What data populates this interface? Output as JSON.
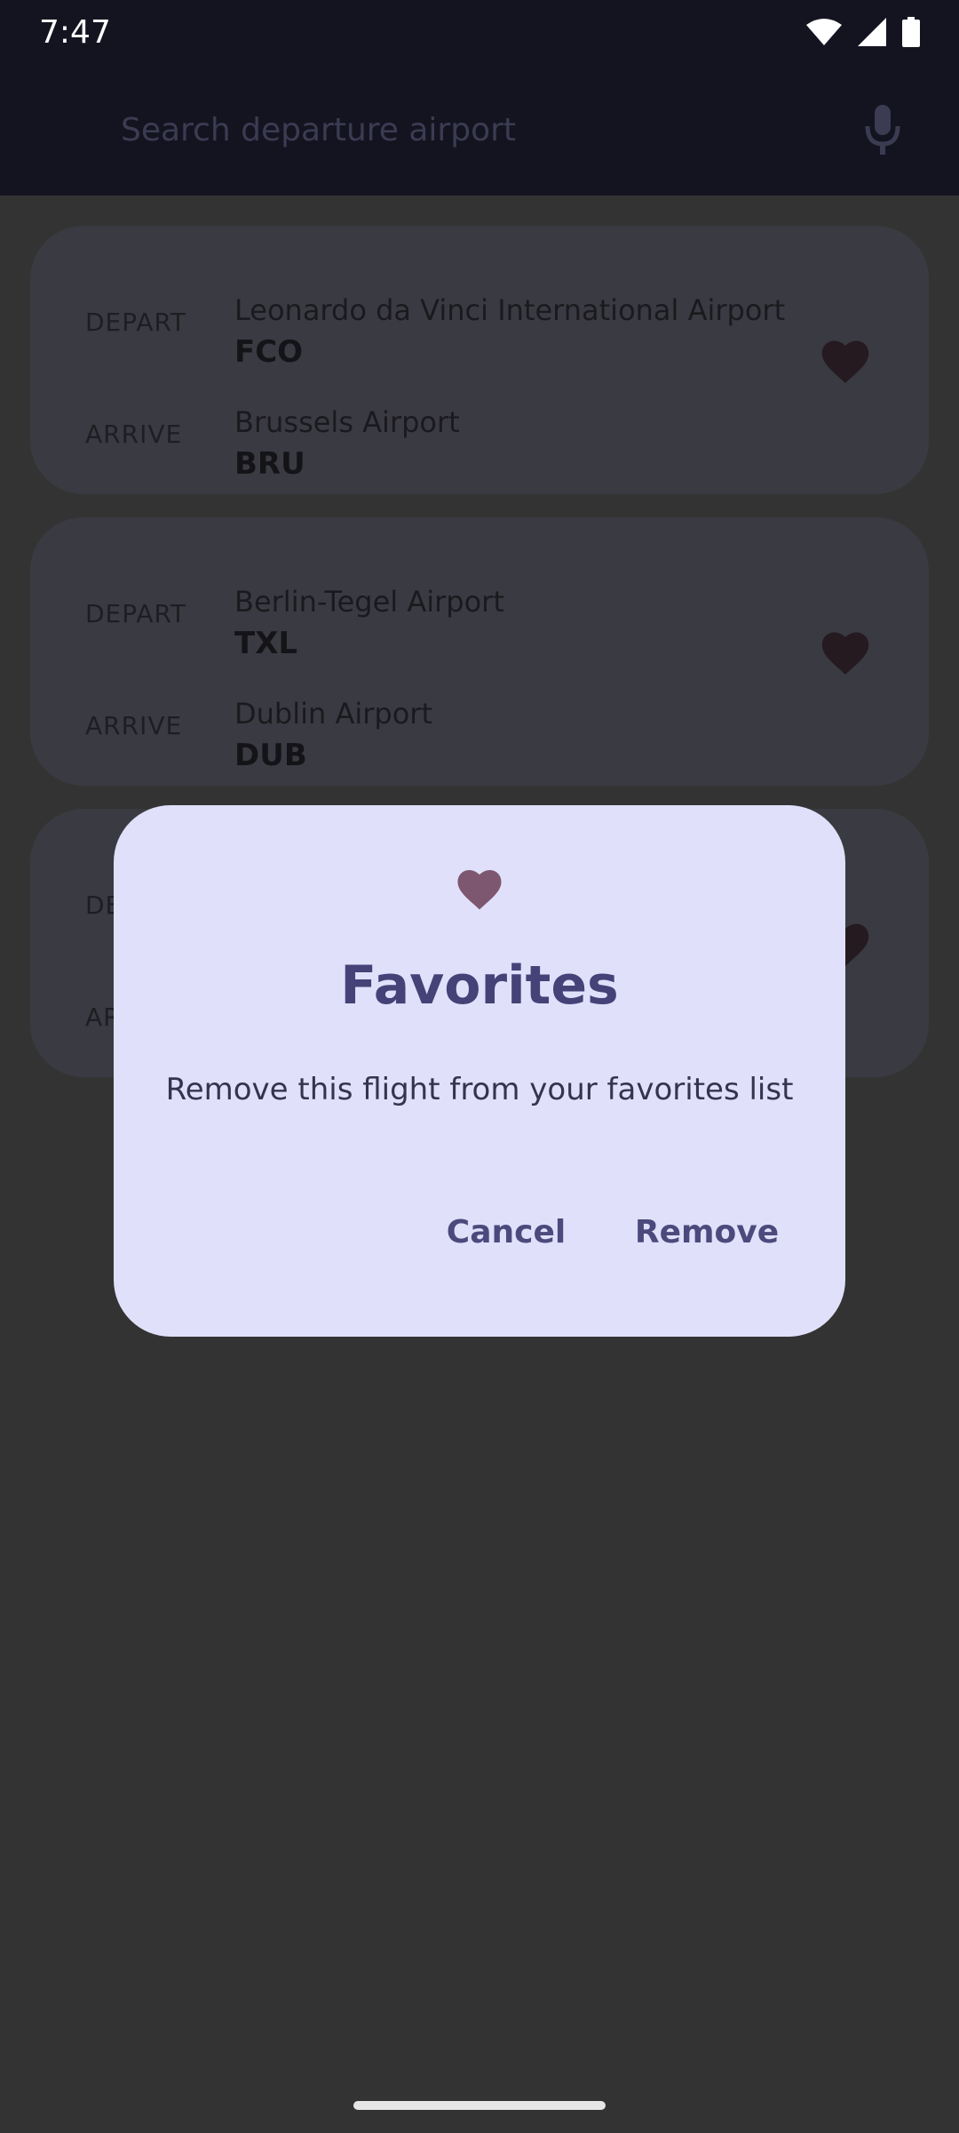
{
  "status": {
    "time": "7:47",
    "icons": [
      "wifi-icon",
      "signal-icon",
      "battery-icon"
    ]
  },
  "search": {
    "placeholder": "Search departure airport",
    "icon": "mic-icon"
  },
  "flights": [
    {
      "depart_label": "DEPART",
      "depart_name": "Leonardo da Vinci International Airport",
      "depart_code": "FCO",
      "arrive_label": "ARRIVE",
      "arrive_name": "Brussels Airport",
      "arrive_code": "BRU"
    },
    {
      "depart_label": "DEPART",
      "depart_name": "Berlin-Tegel Airport",
      "depart_code": "TXL",
      "arrive_label": "ARRIVE",
      "arrive_name": "Dublin Airport",
      "arrive_code": "DUB"
    },
    {
      "depart_label": "DE",
      "arrive_label": "AR"
    }
  ],
  "dialog": {
    "icon": "heart-icon",
    "title": "Favorites",
    "message": "Remove this flight from your favorites list",
    "cancel_label": "Cancel",
    "confirm_label": "Remove"
  },
  "colors": {
    "scrim": "#333333",
    "dialog_bg": "#e0e0fa",
    "accent": "#454278",
    "heart": "#7d5670"
  }
}
